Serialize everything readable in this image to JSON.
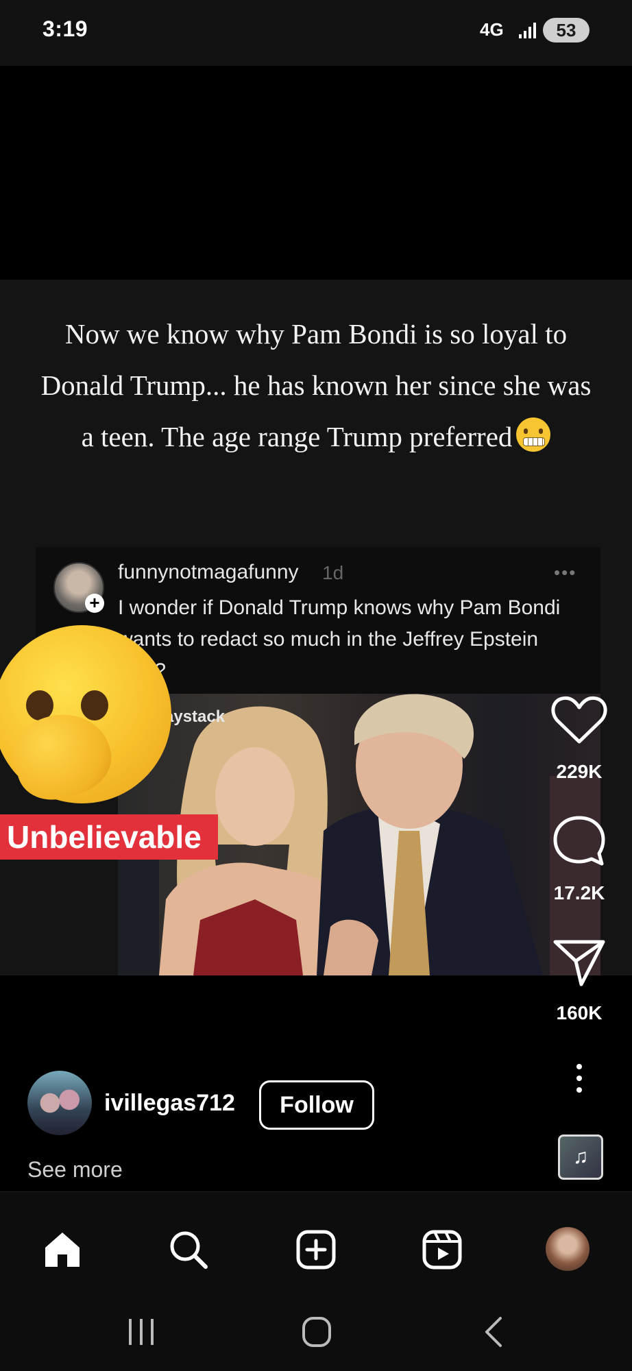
{
  "status_bar": {
    "time": "3:19",
    "network": "4G",
    "battery": "53"
  },
  "post": {
    "caption": "Now we know why Pam Bondi is so loyal to Donald Trump... he has known her since she was a teen. The age range Trump preferred",
    "caption_emoji": "grimacing-face",
    "embedded_comment": {
      "username": "funnynotmagafunny",
      "age": "1d",
      "text": "I wonder if Donald Trump knows why Pam Bondi wants to redact so much in the Jeffrey Epstein files?"
    },
    "photo_label": "aystack",
    "sticker_label": "Unbelievable",
    "sticker_emoji": "face-with-hand-over-mouth"
  },
  "actions": {
    "likes": "229K",
    "comments": "17.2K",
    "shares": "160K"
  },
  "author": {
    "username": "ivillegas712",
    "follow_label": "Follow",
    "see_more_label": "See more"
  },
  "bottom_nav": {
    "items": [
      "home-icon",
      "search-icon",
      "create-icon",
      "reels-icon",
      "profile-avatar"
    ]
  },
  "system_nav": {
    "items": [
      "recent-apps-icon",
      "home-circle-icon",
      "back-icon"
    ]
  }
}
